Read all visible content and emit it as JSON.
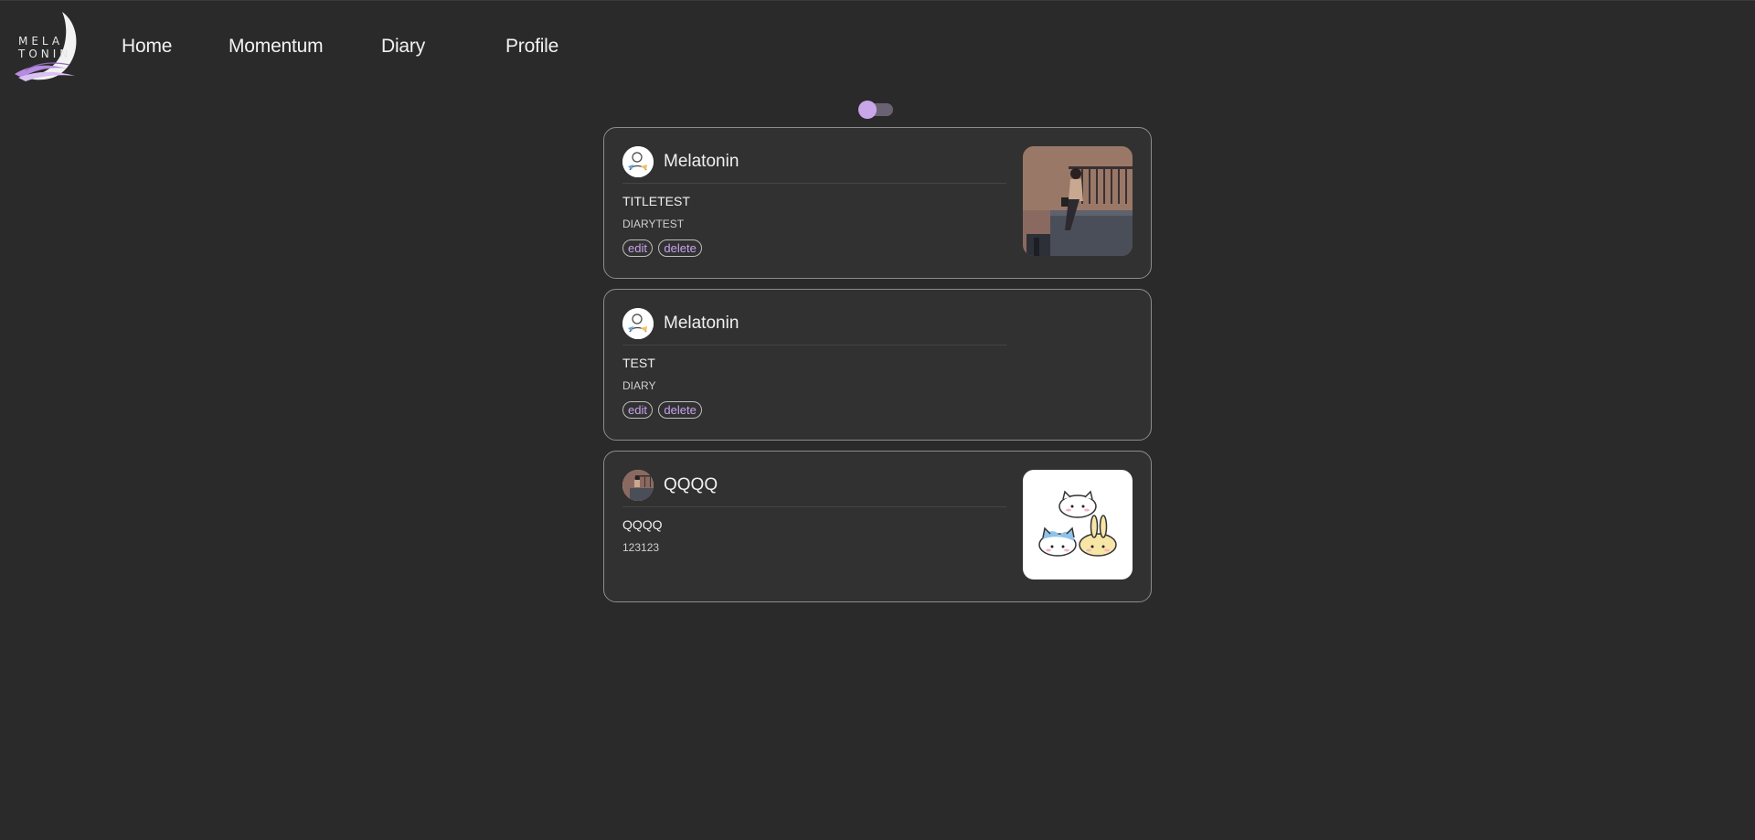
{
  "nav": {
    "logo_text": "MELATONIN",
    "links": [
      "Home",
      "Momentum",
      "Diary",
      "Profile"
    ]
  },
  "theme_toggle": {
    "state": "dark",
    "accent": "#c9a6ea"
  },
  "posts": [
    {
      "author": "Melatonin",
      "title": "TITLETEST",
      "body": "DIARYTEST",
      "edit_label": "edit",
      "delete_label": "delete",
      "avatar_icon": "doodle-avatar-icon",
      "image": "balcony-illustration"
    },
    {
      "author": "Melatonin",
      "title": "TEST",
      "body": "DIARY",
      "edit_label": "edit",
      "delete_label": "delete",
      "avatar_icon": "doodle-avatar-icon"
    },
    {
      "author": "QQQQ",
      "title": "QQQQ",
      "body": "123123",
      "avatar_icon": "balcony-avatar-icon",
      "image": "cute-animals-illustration"
    }
  ],
  "colors": {
    "background": "#2a2a2a",
    "card": "#313131",
    "card_border": "#8c8c8c",
    "accent": "#c7a3ee"
  }
}
